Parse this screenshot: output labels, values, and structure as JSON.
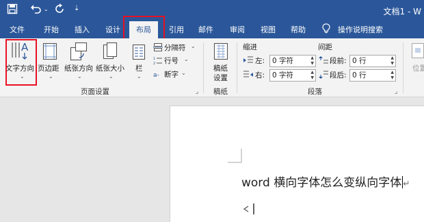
{
  "quick_access": {
    "save_icon": "save-icon",
    "undo_icon": "undo-icon",
    "redo_icon": "redo-icon",
    "customize_icon": "customize-icon"
  },
  "title": "文档1 - W",
  "tabs": [
    "文件",
    "开始",
    "插入",
    "设计",
    "布局",
    "引用",
    "邮件",
    "审阅",
    "视图",
    "帮助"
  ],
  "tell_me": "操作说明搜索",
  "ribbon": {
    "page_setup": {
      "text_direction": "文字方向",
      "margins": "页边距",
      "orientation": "纸张方向",
      "size": "纸张大小",
      "columns": "栏",
      "breaks": "分隔符",
      "line_numbers": "行号",
      "hyphenation": "断字",
      "group_label": "页面设置"
    },
    "manuscript": {
      "button_line1": "稿纸",
      "button_line2": "设置",
      "group_label": "稿纸"
    },
    "paragraph": {
      "indent_label": "缩进",
      "spacing_label": "间距",
      "left_label": "左:",
      "right_label": "右:",
      "before_label": "段前:",
      "after_label": "段后:",
      "left_value": "0 字符",
      "right_value": "0 字符",
      "before_value": "0 行",
      "after_value": "0 行",
      "group_label": "段落"
    },
    "arrange": {
      "position": "位置"
    }
  },
  "document": {
    "text": "word 横向字体怎么变纵向字体",
    "paragraph_mark": "↵"
  },
  "colors": {
    "accent": "#2b579a",
    "highlight": "#e81123"
  }
}
